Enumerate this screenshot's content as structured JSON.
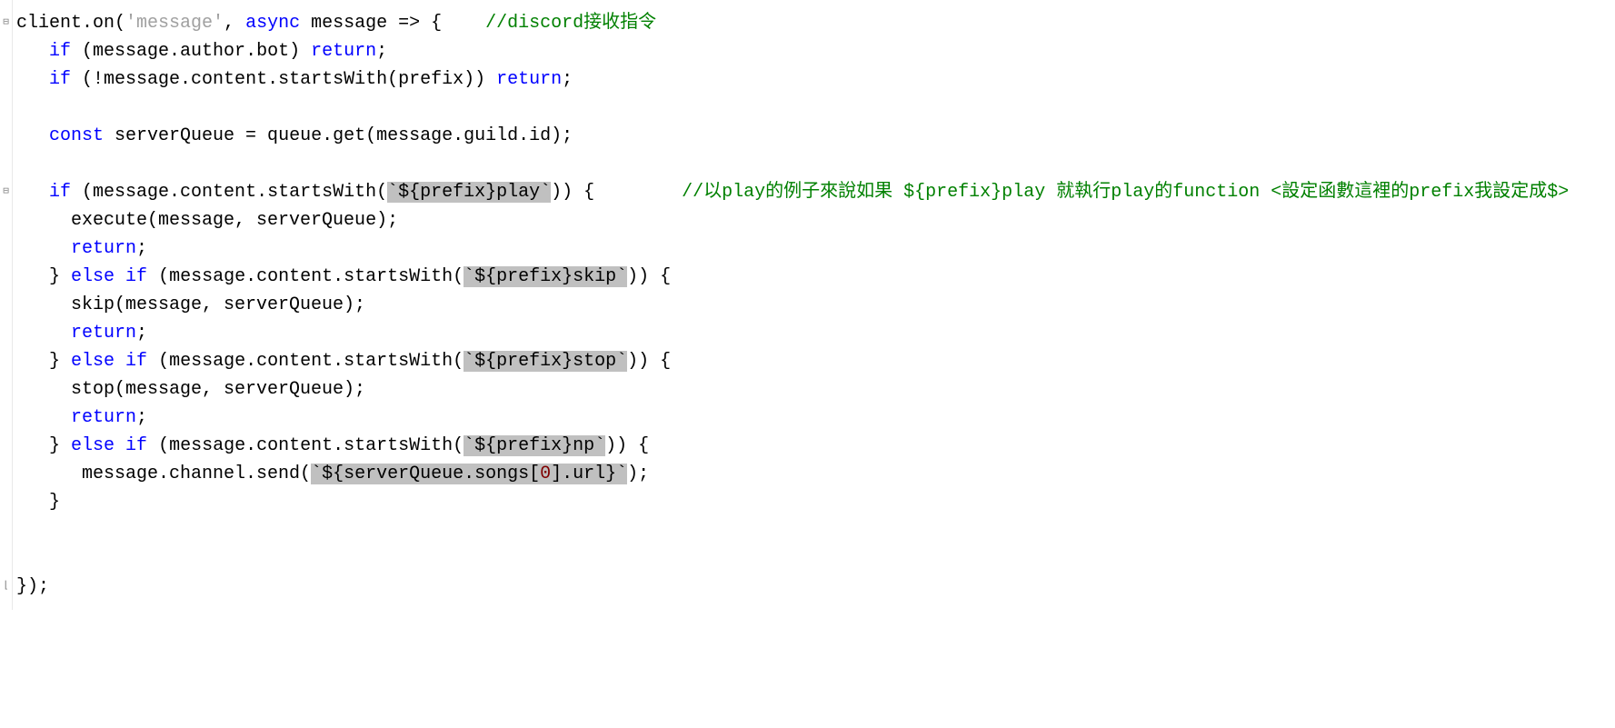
{
  "code": {
    "l1_p1": "client.on(",
    "l1_str": "'message'",
    "l1_p2": ", ",
    "l1_kw": "async",
    "l1_p3": " message => {    ",
    "l1_cmt": "//discord接收指令",
    "l2_p1": "   ",
    "l2_kw1": "if",
    "l2_p2": " (message.author.bot) ",
    "l2_kw2": "return",
    "l2_p3": ";",
    "l3_p1": "   ",
    "l3_kw1": "if",
    "l3_p2": " (!message.content.startsWith(prefix)) ",
    "l3_kw2": "return",
    "l3_p3": ";",
    "l4": "",
    "l5_p1": "   ",
    "l5_kw": "const",
    "l5_p2": " serverQueue = queue.get(message.guild.id);",
    "l6": "",
    "l7_p1": "   ",
    "l7_kw": "if",
    "l7_p2": " (message.content.startsWith(",
    "l7_tmpl": "`${prefix}play`",
    "l7_p3": ")) {        ",
    "l7_cmt": "//以play的例子來說如果 ${prefix}play 就執行play的function <設定函數這裡的prefix我設定成$>",
    "l8": "     execute(message, serverQueue);",
    "l9_p1": "     ",
    "l9_kw": "return",
    "l9_p2": ";",
    "l10_p1": "   } ",
    "l10_kw1": "else",
    "l10_p2": " ",
    "l10_kw2": "if",
    "l10_p3": " (message.content.startsWith(",
    "l10_tmpl": "`${prefix}skip`",
    "l10_p4": ")) {",
    "l11": "     skip(message, serverQueue);",
    "l12_p1": "     ",
    "l12_kw": "return",
    "l12_p2": ";",
    "l13_p1": "   } ",
    "l13_kw1": "else",
    "l13_p2": " ",
    "l13_kw2": "if",
    "l13_p3": " (message.content.startsWith(",
    "l13_tmpl": "`${prefix}stop`",
    "l13_p4": ")) {",
    "l14": "     stop(message, serverQueue);",
    "l15_p1": "     ",
    "l15_kw": "return",
    "l15_p2": ";",
    "l16_p1": "   } ",
    "l16_kw1": "else",
    "l16_p2": " ",
    "l16_kw2": "if",
    "l16_p3": " (message.content.startsWith(",
    "l16_tmpl": "`${prefix}np`",
    "l16_p4": ")) {",
    "l17_p1": "      message.channel.send(",
    "l17_tmpl1": "`${serverQueue.songs[",
    "l17_idx": "0",
    "l17_tmpl2": "].url}`",
    "l17_p2": ");",
    "l18": "   }",
    "l19": "",
    "l20": "",
    "l21": "});"
  },
  "fold": {
    "top": "⊟",
    "mid": "⊟",
    "end": "⌊"
  }
}
